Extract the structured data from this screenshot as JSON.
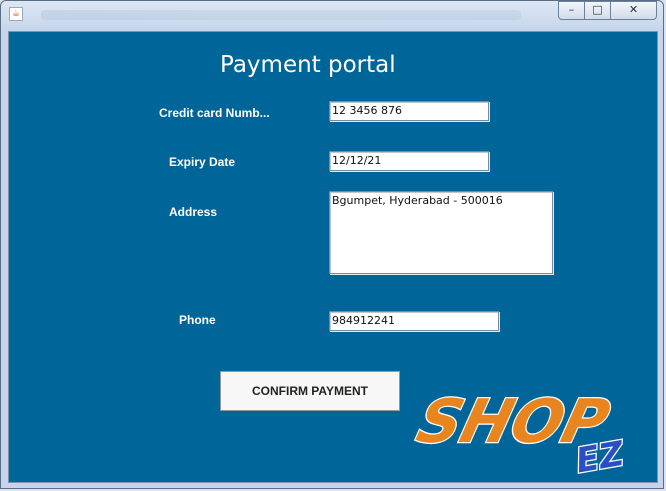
{
  "window": {
    "controls": {
      "minimize": "–",
      "maximize": "□",
      "close": "✕"
    },
    "app_icon": "java-icon"
  },
  "form": {
    "title": "Payment portal",
    "card_label": "Credit card Numb...",
    "card_value": "12 3456 876",
    "expiry_label": "Expiry Date",
    "expiry_value": "12/12/21",
    "address_label": "Address",
    "address_value": "Bgumpet, Hyderabad - 500016",
    "phone_label": "Phone",
    "phone_value": "984912241",
    "confirm_label": "CONFIRM PAYMENT"
  },
  "logo": {
    "main": "SHOP",
    "sub": "EZ",
    "main_color": "#e8851e",
    "sub_color": "#2a4fc4"
  },
  "colors": {
    "panel_bg": "#006699"
  }
}
